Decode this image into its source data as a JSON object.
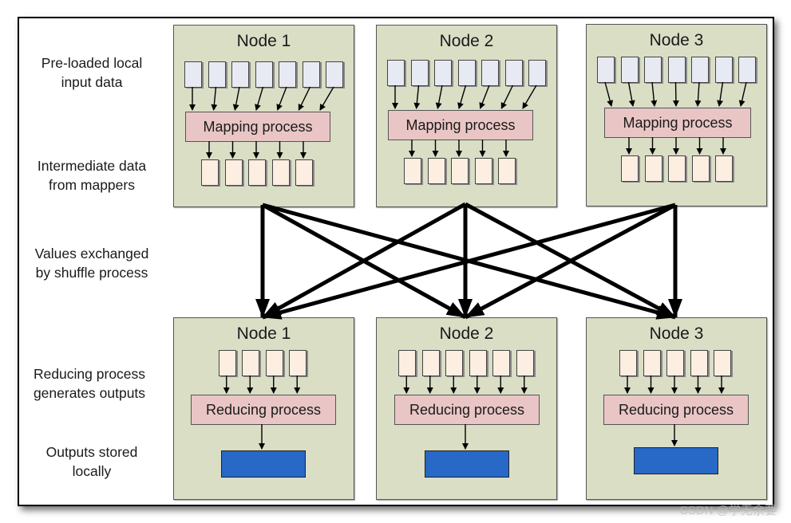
{
  "row_labels": {
    "input": "Pre-loaded local\ninput data",
    "intermediate": "Intermediate data\nfrom mappers",
    "shuffle": "Values exchanged\nby shuffle process",
    "reducing": "Reducing process\ngenerates outputs",
    "outputs": "Outputs stored\nlocally"
  },
  "map_nodes": [
    {
      "title": "Node 1",
      "process": "Mapping process",
      "input_blocks": 7,
      "intermediate_blocks": 5
    },
    {
      "title": "Node 2",
      "process": "Mapping process",
      "input_blocks": 7,
      "intermediate_blocks": 5
    },
    {
      "title": "Node 3",
      "process": "Mapping process",
      "input_blocks": 7,
      "intermediate_blocks": 5
    }
  ],
  "reduce_nodes": [
    {
      "title": "Node 1",
      "process": "Reducing process",
      "input_blocks": 4,
      "output_blocks": 1
    },
    {
      "title": "Node 2",
      "process": "Reducing process",
      "input_blocks": 6,
      "output_blocks": 1
    },
    {
      "title": "Node 3",
      "process": "Reducing process",
      "input_blocks": 5,
      "output_blocks": 1
    }
  ],
  "shuffle_edges": [
    {
      "from": "Node 1",
      "to": "Node 1"
    },
    {
      "from": "Node 1",
      "to": "Node 2"
    },
    {
      "from": "Node 1",
      "to": "Node 3"
    },
    {
      "from": "Node 2",
      "to": "Node 1"
    },
    {
      "from": "Node 2",
      "to": "Node 2"
    },
    {
      "from": "Node 2",
      "to": "Node 3"
    },
    {
      "from": "Node 3",
      "to": "Node 1"
    },
    {
      "from": "Node 3",
      "to": "Node 2"
    },
    {
      "from": "Node 3",
      "to": "Node 3"
    }
  ],
  "colors": {
    "node_bg": "#d9dec5",
    "input_block": "#e8eaf3",
    "intermediate_block": "#fdeee2",
    "process_box": "#e9c6c5",
    "output_block": "#2868c6"
  },
  "watermark": "CSDN @学无余要"
}
